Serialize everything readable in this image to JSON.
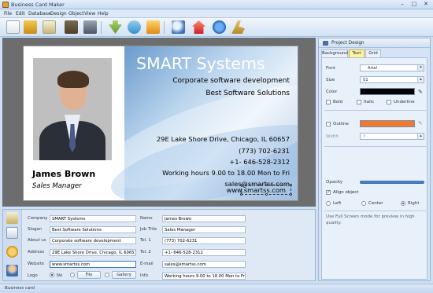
{
  "window": {
    "title": "Business Card Maker"
  },
  "menu": [
    "File",
    "Edit",
    "Database",
    "Design",
    "Object",
    "View",
    "Help"
  ],
  "card": {
    "name": "James Brown",
    "position": "Sales Manager",
    "company": "SMART Systems",
    "slogan": "Corporate software development",
    "about": "Best Software Solutions",
    "address": "29E Lake Shore Drive, Chicago, IL 60657",
    "tel1": "(773) 702-6231",
    "tel2": "+1- 646-528-2312",
    "info": "Working hours 9.00 to 18.00 Mon to Fri",
    "email": "sales@smartss.com",
    "website": "www.smartss.com"
  },
  "form": {
    "labels": {
      "company": "Company",
      "slogan": "Slogan",
      "about": "About us",
      "address": "Address",
      "website": "Website",
      "logo": "Logo",
      "name": "Name",
      "job_title": "Job Title",
      "tel1": "Tel. 1",
      "tel2": "Tel. 2",
      "email": "E-mail",
      "info": "Info"
    },
    "values": {
      "company": "SMART Systems",
      "slogan": "Best Software Solutions",
      "about": "Corporate software development",
      "address": "29E Lake Shore Drive, Chicago, IL 60657",
      "website": "www.smartss.com",
      "name": "James Brown",
      "job_title": "Sales Manager",
      "tel1": "(773) 702-6231",
      "tel2": "+1- 646-528-2312",
      "email": "sales@smartss.com",
      "info": "Working hours 9.00 to 18.00 Mon to Fri"
    },
    "logo_options": {
      "no": "No",
      "file": "File",
      "gallery": "Gallery"
    }
  },
  "panel": {
    "title": "Project Design",
    "tabs": [
      "Background",
      "Text",
      "Grid"
    ],
    "active_tab": "Text",
    "font_label": "Font",
    "font_value": "Arial",
    "size_label": "Size",
    "size_value": "51",
    "color_label": "Color",
    "color_value": "#000000",
    "bold": "Bold",
    "italic": "Italic",
    "underline": "Underline",
    "outline": "Outline",
    "outline_color": "#f07a30",
    "width_label": "Width",
    "width_value": "3",
    "opacity": "Opacity",
    "align": "Align object",
    "left": "Left",
    "center": "Center",
    "right": "Right",
    "align_value": "Right",
    "hint": "Use Full Screen mode for preview in high quality."
  },
  "status": {
    "text": "Business card"
  },
  "colors": {
    "accent": "#3a78c8",
    "panel_bg": "#d5e3f4"
  }
}
